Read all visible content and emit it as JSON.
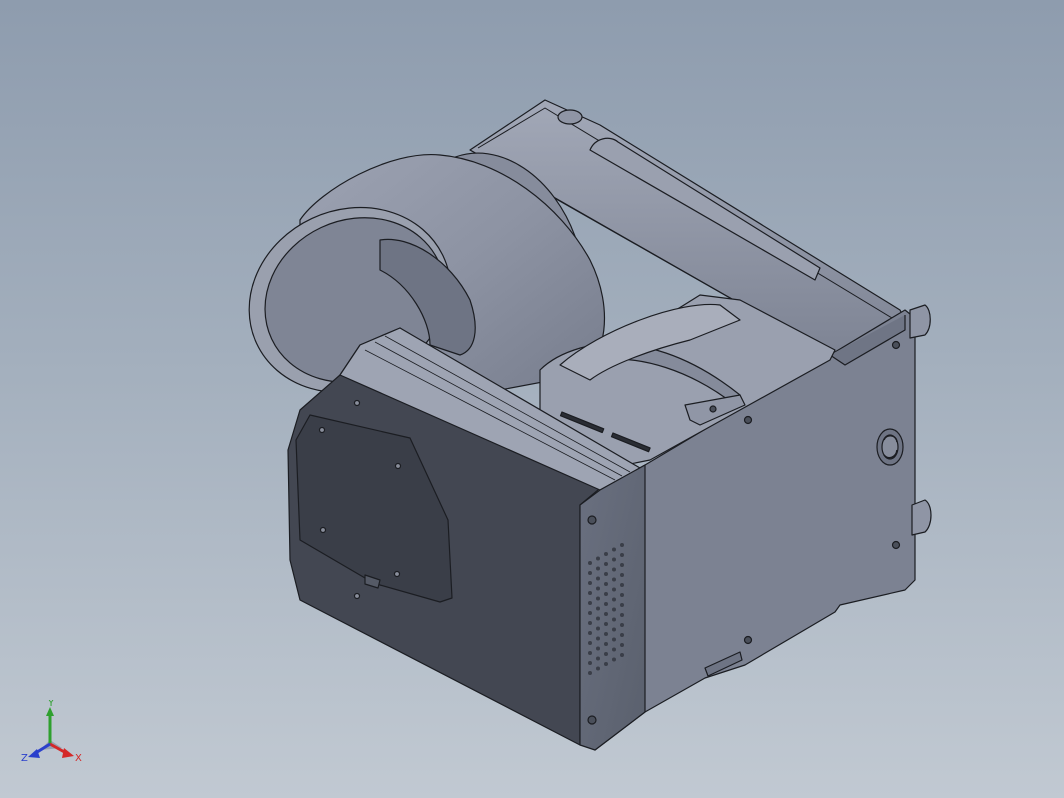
{
  "viewport": {
    "background_top": "#8e9cae",
    "background_bottom": "#c1c9d2"
  },
  "model": {
    "icon": "cad-dispenser-assembly",
    "colors": {
      "dark_face": "#3f434d",
      "mid_face": "#5b616e",
      "light_face": "#8c92a2",
      "highlight": "#a9aebb",
      "edge": "#1b1d22"
    }
  },
  "triad": {
    "x_label": "X",
    "y_label": "Y",
    "z_label": "Z",
    "colors": {
      "x": "#d42828",
      "y": "#2ea02e",
      "z": "#2a3fcc"
    }
  }
}
